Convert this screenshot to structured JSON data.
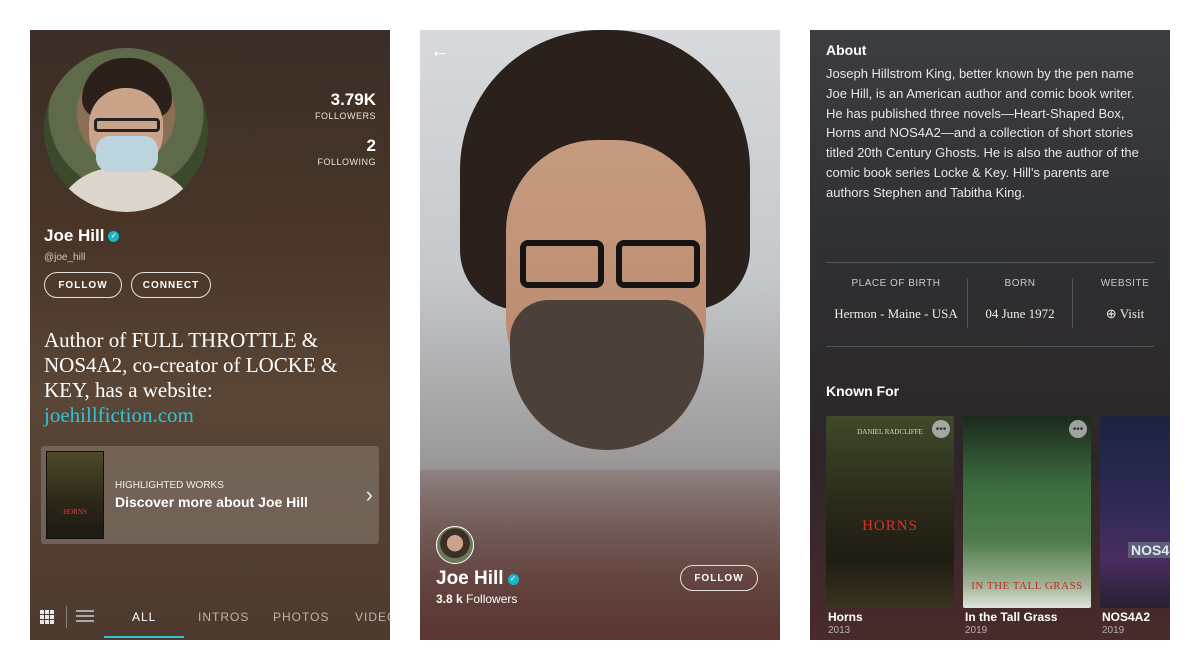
{
  "profile": {
    "name": "Joe Hill",
    "handle": "@joe_hill",
    "verified_mark": "✓",
    "followers_count": "3.79K",
    "followers_label": "FOLLOWERS",
    "following_count": "2",
    "following_label": "FOLLOWING",
    "follow_label": "FOLLOW",
    "connect_label": "CONNECT",
    "bio_text": "Author of FULL THROTTLE & NOS4A2, co-creator of LOCKE & KEY, has a website: ",
    "bio_link": "joehillfiction.com",
    "highlight": {
      "label": "HIGHLIGHTED WORKS",
      "title": "Discover more about Joe Hill",
      "poster_text": "HORNS",
      "chevron_icon": "chevron-right-icon"
    },
    "tabs": [
      "ALL",
      "INTROS",
      "PHOTOS",
      "VIDEO"
    ],
    "active_tab": "ALL",
    "accent_color": "#2fc4d8"
  },
  "hero": {
    "back_icon": "arrow-left-icon",
    "name": "Joe Hill",
    "followers_count": "3.8 k",
    "followers_label": "Followers",
    "follow_label": "FOLLOW"
  },
  "about": {
    "heading": "About",
    "text": "Joseph Hillstrom King, better known by the pen name Joe Hill, is an American author and comic book writer. He has published three novels—Heart-Shaped Box, Horns and NOS4A2—and a collection of short stories titled 20th Century Ghosts. He is also the author of the comic book series Locke & Key. Hill's parents are authors Stephen and Tabitha King.",
    "facts": [
      {
        "label": "PLACE OF BIRTH",
        "value": "Hermon - Maine - USA"
      },
      {
        "label": "BORN",
        "value": "04 June 1972"
      },
      {
        "label": "WEBSITE",
        "value": "Visit"
      }
    ],
    "known_for_heading": "Known For",
    "known_for": [
      {
        "title": "Horns",
        "year": "2013",
        "poster_text": "HORNS",
        "poster_sub": "DANIEL RADCLIFFE"
      },
      {
        "title": "In the Tall Grass",
        "year": "2019",
        "poster_text": "IN THE TALL GRASS"
      },
      {
        "title": "NOS4A2",
        "year": "2019",
        "poster_text": "NOS4"
      }
    ],
    "more_glyph": "•••"
  }
}
